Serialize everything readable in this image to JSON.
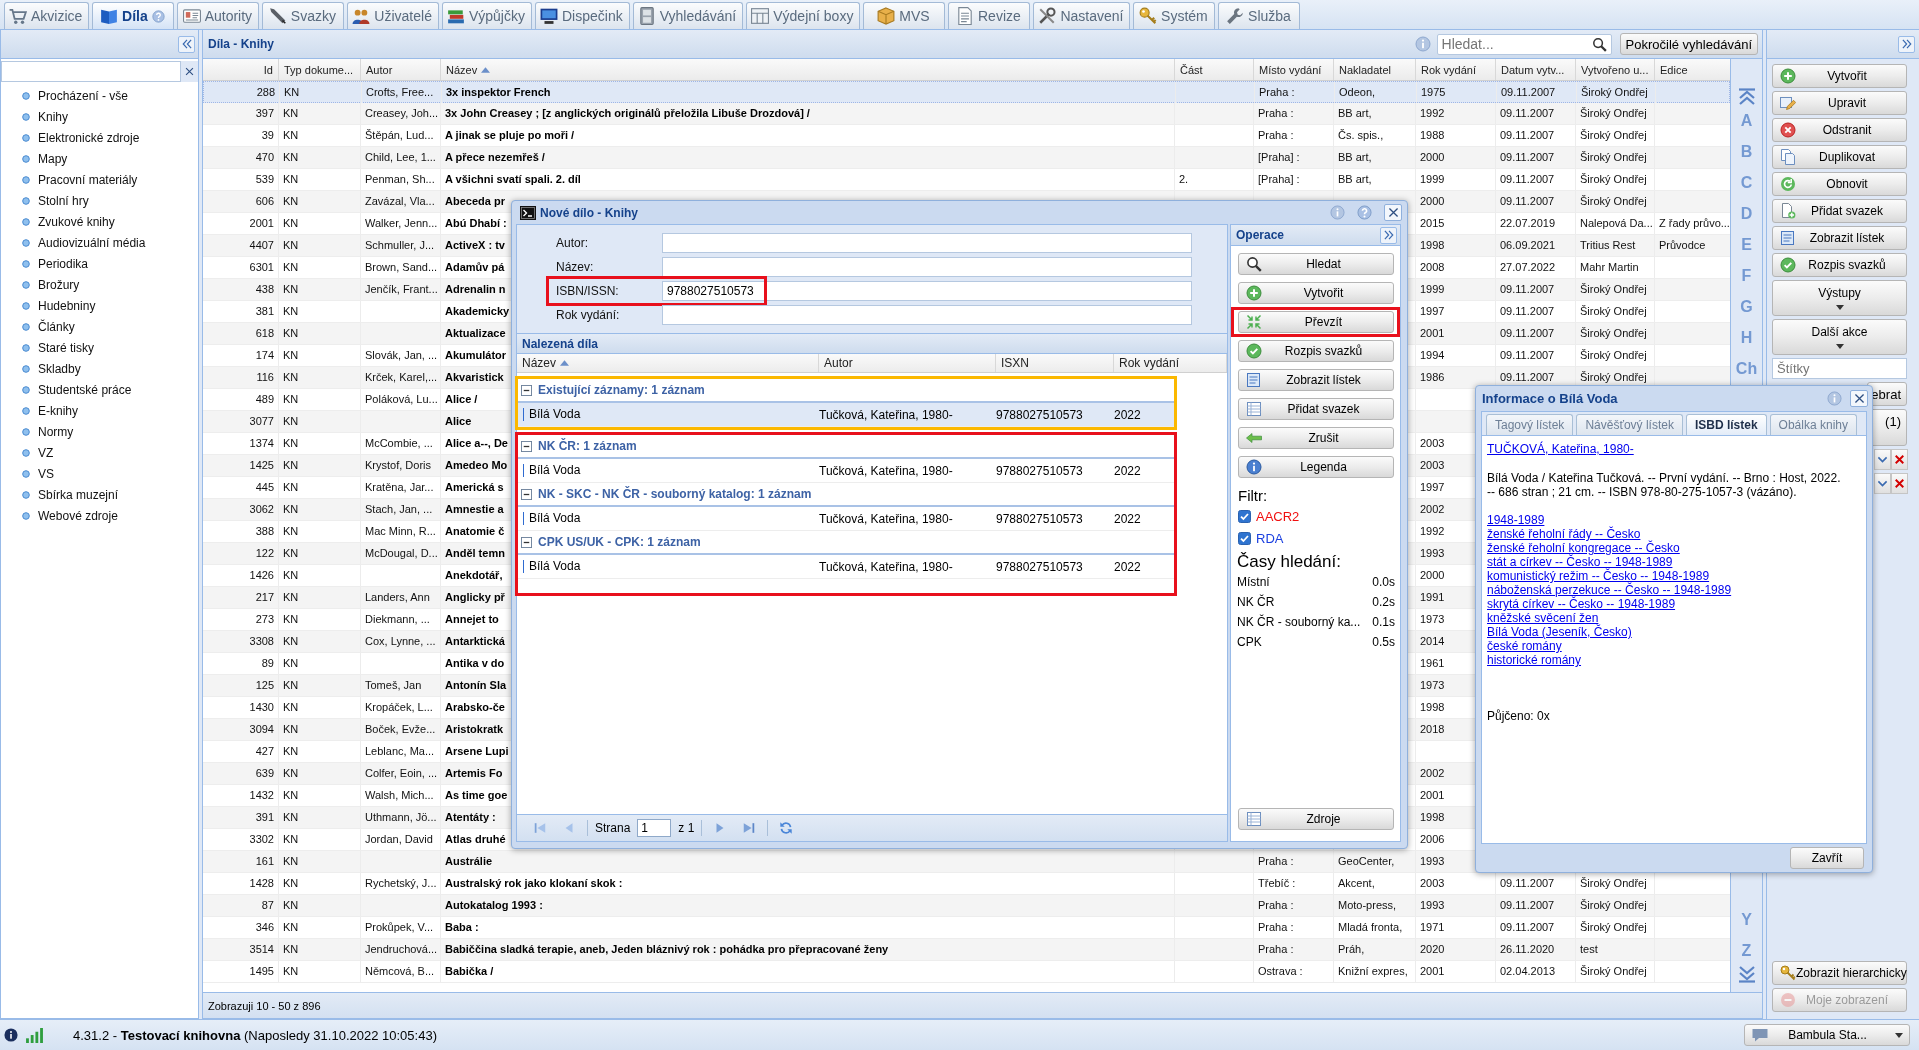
{
  "tabs": [
    {
      "label": "Akvizice",
      "selected": false
    },
    {
      "label": "Díla",
      "selected": true
    },
    {
      "label": "Autority",
      "selected": false
    },
    {
      "label": "Svazky",
      "selected": false
    },
    {
      "label": "Uživatelé",
      "selected": false
    },
    {
      "label": "Výpůjčky",
      "selected": false
    },
    {
      "label": "Dispečink",
      "selected": false
    },
    {
      "label": "Vyhledávání",
      "selected": false
    },
    {
      "label": "Výdejní boxy",
      "selected": false
    },
    {
      "label": "MVS",
      "selected": false
    },
    {
      "label": "Revize",
      "selected": false
    },
    {
      "label": "Nastavení",
      "selected": false
    },
    {
      "label": "Systém",
      "selected": false
    },
    {
      "label": "Služba",
      "selected": false
    }
  ],
  "sidebar": {
    "items": [
      "Procházení - vše",
      "Knihy",
      "Elektronické zdroje",
      "Mapy",
      "Pracovní materiály",
      "Stolní hry",
      "Zvukové knihy",
      "Audiovizuální média",
      "Periodika",
      "Brožury",
      "Hudebniny",
      "Články",
      "Staré tisky",
      "Skladby",
      "Studentské práce",
      "E-knihy",
      "Normy",
      "VZ",
      "VS",
      "Sbírka muzejní",
      "Webové zdroje"
    ]
  },
  "grid": {
    "title": "Díla - Knihy",
    "search": {
      "placeholder": "Hledat..."
    },
    "advanced_button": "Pokročilé vyhledávání",
    "columns": [
      {
        "label": "Id",
        "sorted": false
      },
      {
        "label": "Typ dokume...",
        "sorted": false
      },
      {
        "label": "Autor",
        "sorted": false
      },
      {
        "label": "Název",
        "sorted": true
      },
      {
        "label": "Část",
        "sorted": false
      },
      {
        "label": "Místo vydání",
        "sorted": false
      },
      {
        "label": "Nakladatel",
        "sorted": false
      },
      {
        "label": "Rok vydání",
        "sorted": false
      },
      {
        "label": "Datum vytv...",
        "sorted": false
      },
      {
        "label": "Vytvořeno u...",
        "sorted": false
      },
      {
        "label": "Edice",
        "sorted": false
      }
    ],
    "rows": [
      {
        "id": "288",
        "type": "KN",
        "author": "Crofts, Free...",
        "title": "3x inspektor French",
        "place": "Praha :",
        "publisher": "Odeon,",
        "year": "1975",
        "created": "09.11.2007",
        "created_by": "Široký Ondřej",
        "selected": true
      },
      {
        "id": "397",
        "type": "KN",
        "author": "Creasey, Joh...",
        "title": "3x John Creasey ; [z anglických originálů přeložila Libuše Drozdová] /",
        "place": "Praha :",
        "publisher": "BB art,",
        "year": "1992",
        "created": "09.11.2007",
        "created_by": "Široký Ondřej",
        "selected": false
      },
      {
        "id": "39",
        "type": "KN",
        "author": "Štěpán, Lud...",
        "title": "A jinak se pluje po moři /",
        "place": "Praha :",
        "publisher": "Čs. spis.,",
        "year": "1988",
        "created": "09.11.2007",
        "created_by": "Široký Ondřej",
        "selected": false
      },
      {
        "id": "470",
        "type": "KN",
        "author": "Child, Lee, 1...",
        "title": "A přece nezemřeš /",
        "place": "[Praha] :",
        "publisher": "BB art,",
        "year": "2000",
        "created": "09.11.2007",
        "created_by": "Široký Ondřej",
        "selected": false
      },
      {
        "id": "539",
        "type": "KN",
        "author": "Penman, Sh...",
        "title": "A všichni svatí spali. 2. díl",
        "part": "2.",
        "place": "[Praha] :",
        "publisher": "BB art,",
        "year": "1999",
        "created": "09.11.2007",
        "created_by": "Široký Ondřej",
        "selected": false
      },
      {
        "id": "606",
        "type": "KN",
        "author": "Zavázal, Vla...",
        "title": "Abeceda pr",
        "year": "2000",
        "created": "09.11.2007",
        "created_by": "Široký Ondřej",
        "selected": false
      },
      {
        "id": "2001",
        "type": "KN",
        "author": "Walker, Jenn...",
        "title": "Abú Dhabí :",
        "year": "2015",
        "created": "22.07.2019",
        "created_by": "Nalepová Da...",
        "edition": "Z řady průvo...",
        "selected": false
      },
      {
        "id": "4407",
        "type": "KN",
        "author": "Schmuller, J...",
        "title": "ActiveX : tv",
        "year": "1998",
        "created": "06.09.2021",
        "created_by": "Tritius Rest",
        "edition": "Průvodce",
        "selected": false
      },
      {
        "id": "6301",
        "type": "KN",
        "author": "Brown, Sand...",
        "title": "Adamův pá",
        "year": "2008",
        "created": "27.07.2022",
        "created_by": "Mahr Martin",
        "selected": false
      },
      {
        "id": "438",
        "type": "KN",
        "author": "Jenčík, Frant...",
        "title": "Adrenalin n",
        "year": "1999",
        "created": "09.11.2007",
        "created_by": "Široký Ondřej",
        "selected": false
      },
      {
        "id": "381",
        "type": "KN",
        "title": "Akademicky",
        "year": "1997",
        "created": "09.11.2007",
        "created_by": "Široký Ondřej",
        "selected": false
      },
      {
        "id": "618",
        "type": "KN",
        "title": "Aktualizace",
        "year": "2001",
        "created": "09.11.2007",
        "created_by": "Široký Ondřej",
        "selected": false
      },
      {
        "id": "174",
        "type": "KN",
        "author": "Slovák, Jan, ...",
        "title": "Akumulátor",
        "year": "1994",
        "created": "09.11.2007",
        "created_by": "Široký Ondřej",
        "selected": false
      },
      {
        "id": "116",
        "type": "KN",
        "author": "Krček, Karel,...",
        "title": "Akvaristick",
        "year": "1986",
        "created": "09.11.2007",
        "created_by": "Široký Ondřej",
        "selected": false
      },
      {
        "id": "489",
        "type": "KN",
        "author": "Poláková, Lu...",
        "title": "Alice /",
        "selected": false
      },
      {
        "id": "3077",
        "type": "KN",
        "title": "Alice",
        "selected": false
      },
      {
        "id": "1374",
        "type": "KN",
        "author": "McCombie, ...",
        "title": "Alice a--, De",
        "year": "2003",
        "selected": false
      },
      {
        "id": "1425",
        "type": "KN",
        "author": "Krystof, Doris",
        "title": "Amedeo Mo",
        "year": "2003",
        "selected": false
      },
      {
        "id": "445",
        "type": "KN",
        "author": "Kratěna, Jar...",
        "title": "Americká s",
        "year": "1997",
        "selected": false
      },
      {
        "id": "3062",
        "type": "KN",
        "author": "Stach, Jan, ...",
        "title": "Amnestie a",
        "year": "2002",
        "selected": false
      },
      {
        "id": "388",
        "type": "KN",
        "author": "Mac Minn, R...",
        "title": "Anatomie č",
        "year": "1992",
        "selected": false
      },
      {
        "id": "122",
        "type": "KN",
        "author": "McDougal, D...",
        "title": "Anděl temn",
        "year": "1993",
        "selected": false
      },
      {
        "id": "1426",
        "type": "KN",
        "title": "Anekdotář,",
        "year": "2000",
        "selected": false
      },
      {
        "id": "217",
        "type": "KN",
        "author": "Landers, Ann",
        "title": "Anglicky př",
        "year": "1991",
        "selected": false
      },
      {
        "id": "273",
        "type": "KN",
        "author": "Diekmann, ...",
        "title": "Annejet to",
        "year": "1973",
        "selected": false
      },
      {
        "id": "3308",
        "type": "KN",
        "author": "Cox, Lynne, ...",
        "title": "Antarktická",
        "year": "2014",
        "selected": false
      },
      {
        "id": "89",
        "type": "KN",
        "title": "Antika v do",
        "year": "1961",
        "selected": false
      },
      {
        "id": "125",
        "type": "KN",
        "author": "Tomeš, Jan",
        "title": "Antonín Sla",
        "year": "1973",
        "selected": false
      },
      {
        "id": "1430",
        "type": "KN",
        "author": "Kropáček, L...",
        "title": "Arabsko-če",
        "year": "1998",
        "selected": false
      },
      {
        "id": "3094",
        "type": "KN",
        "author": "Boček, Evže...",
        "title": "Aristokratk",
        "year": "2018",
        "selected": false
      },
      {
        "id": "427",
        "type": "KN",
        "author": "Leblanc, Ma...",
        "title": "Arsene Lupi",
        "selected": false
      },
      {
        "id": "639",
        "type": "KN",
        "author": "Colfer, Eoin, ...",
        "title": "Artemis Fo",
        "year": "2002",
        "selected": false
      },
      {
        "id": "1432",
        "type": "KN",
        "author": "Walsh, Mich...",
        "title": "As time goe",
        "year": "2001",
        "selected": false
      },
      {
        "id": "391",
        "type": "KN",
        "author": "Uthmann, Jö...",
        "title": "Atentáty :",
        "year": "1998",
        "selected": false
      },
      {
        "id": "3302",
        "type": "KN",
        "author": "Jordan, David",
        "title": "Atlas druhé",
        "year": "2006",
        "selected": false
      },
      {
        "id": "161",
        "type": "KN",
        "title": "Austrálie",
        "place": "Praha :",
        "publisher": "GeoCenter,",
        "year": "1993",
        "selected": false
      },
      {
        "id": "1428",
        "type": "KN",
        "author": "Rychetský, J...",
        "title": "Australský rok jako klokaní skok :",
        "place": "Třebíč :",
        "publisher": "Akcent,",
        "year": "2003",
        "created": "09.11.2007",
        "created_by": "Široký Ondřej",
        "selected": false
      },
      {
        "id": "87",
        "type": "KN",
        "title": "Autokatalog 1993 :",
        "place": "Praha :",
        "publisher": "Moto-press,",
        "year": "1993",
        "created": "09.11.2007",
        "created_by": "Široký Ondřej",
        "selected": false
      },
      {
        "id": "346",
        "type": "KN",
        "author": "Prokůpek, V...",
        "title": "Baba :",
        "place": "Praha :",
        "publisher": "Mladá fronta,",
        "year": "1971",
        "created": "09.11.2007",
        "created_by": "Široký Ondřej",
        "selected": false
      },
      {
        "id": "3514",
        "type": "KN",
        "author": "Jendruchová...",
        "title": "Babiččina sladká terapie, aneb, Jeden bláznivý rok : pohádka pro přepracované ženy",
        "place": "Praha :",
        "publisher": "Práh,",
        "year": "2020",
        "created": "26.11.2020",
        "created_by": "test",
        "selected": false
      },
      {
        "id": "1495",
        "type": "KN",
        "author": "Němcová, B...",
        "title": "Babička /",
        "place": "Ostrava :",
        "publisher": "Knižní expres,",
        "year": "2001",
        "created": "02.04.2013",
        "created_by": "Široký Ondřej",
        "selected": false
      }
    ],
    "alphabet": {
      "top": [
        "A",
        "B",
        "C",
        "D",
        "E",
        "F",
        "G",
        "H",
        "Ch"
      ],
      "bottom": [
        "Y",
        "Z"
      ]
    },
    "footer": "Zobrazuji 10 - 50 z 896"
  },
  "actions": {
    "buttons": [
      "Vytvořit",
      "Upravit",
      "Odstranit",
      "Duplikovat",
      "Obnovit",
      "Přidat svazek",
      "Zobrazit lístek",
      "Rozpis svazků"
    ],
    "menus": [
      "Výstupy",
      "Další akce"
    ],
    "tags": {
      "placeholder": "Štítky"
    },
    "partial_buttons": [
      "ebrat",
      "(1)"
    ],
    "bottom": [
      {
        "label": "Zobrazit hierarchicky",
        "disabled": false
      },
      {
        "label": "Moje zobrazení",
        "disabled": true
      }
    ]
  },
  "status_bar": {
    "text": "4.31.2 - **Testovací knihovna** (Naposledy 31.10.2022 10:05:43)",
    "user": "Bambula Sta..."
  },
  "dialog": {
    "title": "Nové dílo - Knihy",
    "fields": [
      {
        "label": "Autor:",
        "highlighted": false
      },
      {
        "label": "Název:",
        "highlighted": false
      },
      {
        "label": "ISBN/ISSN:",
        "value": "9788027510573",
        "highlighted": true
      },
      {
        "label": "Rok vydání:",
        "highlighted": false
      }
    ],
    "results": {
      "title": "Nalezená díla",
      "columns": [
        {
          "label": "Název",
          "sorted": true
        },
        {
          "label": "Autor",
          "sorted": false
        },
        {
          "label": "ISXN",
          "sorted": false
        },
        {
          "label": "Rok vydání",
          "sorted": false
        }
      ],
      "frames": [
        {
          "color": "#fbb800",
          "groups": [
            {
              "title": "Existující záznamy: 1 záznam",
              "expanded": true,
              "rows": [
                {
                  "title": "Bílá Voda",
                  "author": "Tučková, Kateřina, 1980-",
                  "isxn": "9788027510573",
                  "year": "2022",
                  "selected": true
                }
              ]
            }
          ]
        },
        {
          "color": "#e8101c",
          "groups": [
            {
              "title": "NK ČR: 1 záznam",
              "expanded": true,
              "rows": [
                {
                  "title": "Bílá Voda",
                  "author": "Tučková, Kateřina, 1980-",
                  "isxn": "9788027510573",
                  "year": "2022",
                  "selected": false
                }
              ]
            },
            {
              "title": "NK - SKC - NK ČR - souborný katalog: 1 záznam",
              "expanded": true,
              "rows": [
                {
                  "title": "Bílá Voda",
                  "author": "Tučková, Kateřina, 1980-",
                  "isxn": "9788027510573",
                  "year": "2022",
                  "selected": false
                }
              ]
            },
            {
              "title": "CPK US/UK - CPK: 1 záznam",
              "expanded": true,
              "rows": [
                {
                  "title": "Bílá Voda",
                  "author": "Tučková, Kateřina, 1980-",
                  "isxn": "9788027510573",
                  "year": "2022",
                  "selected": false
                }
              ]
            }
          ]
        }
      ]
    },
    "pager": {
      "label": "Strana",
      "page": "1",
      "total": "z 1"
    },
    "operations": {
      "title": "Operace",
      "buttons": [
        {
          "label": "Hledat",
          "highlighted": false
        },
        {
          "label": "Vytvořit",
          "highlighted": false
        },
        {
          "label": "Převzít",
          "highlighted": true
        },
        {
          "label": "Rozpis svazků",
          "highlighted": false
        },
        {
          "label": "Zobrazit lístek",
          "highlighted": false
        },
        {
          "label": "Přidat svazek",
          "highlighted": false
        },
        {
          "label": "Zrušit",
          "highlighted": false
        },
        {
          "label": "Legenda",
          "highlighted": false
        }
      ],
      "filter": {
        "label": "Filtr:",
        "options": [
          {
            "label": "AACR2",
            "checked": true,
            "color": "#f01010"
          },
          {
            "label": "RDA",
            "checked": true,
            "color": "#1a3fe0"
          }
        ]
      },
      "times": {
        "title": "Časy hledání:",
        "rows": [
          {
            "source": "Místní",
            "time": "0.0s"
          },
          {
            "source": "NK ČR",
            "time": "0.2s"
          },
          {
            "source": "NK ČR - souborný ka...",
            "time": "0.1s"
          },
          {
            "source": "CPK",
            "time": "0.5s"
          }
        ]
      },
      "sources_button": "Zdroje"
    }
  },
  "info": {
    "title": "Informace o Bílá Voda",
    "tabs": [
      {
        "label": "Tagový lístek",
        "selected": false
      },
      {
        "label": "Návěšťový lístek",
        "selected": false
      },
      {
        "label": "ISBD lístek",
        "selected": true
      },
      {
        "label": "Obálka knihy",
        "selected": false
      }
    ],
    "author_link": "TUČKOVÁ, Kateřina, 1980-",
    "description": "Bílá Voda / Kateřina Tučková. -- První vydání. -- Brno : Host, 2022. -- 686 stran ; 21 cm. -- ISBN 978-80-275-1057-3 (vázáno).",
    "subject_links": [
      "1948-1989",
      "ženské řeholní řády -- Česko",
      "ženské řeholní kongregace -- Česko",
      "stát a církev -- Česko -- 1948-1989",
      "komunistický režim -- Česko -- 1948-1989",
      "náboženská perzekuce -- Česko -- 1948-1989",
      "skrytá církev -- Česko -- 1948-1989",
      "kněžské svěcení žen",
      "Bílá Voda (Jeseník, Česko)",
      "české romány",
      "historické romány"
    ],
    "loans": "Půjčeno: 0x",
    "close_button": "Zavřít"
  }
}
